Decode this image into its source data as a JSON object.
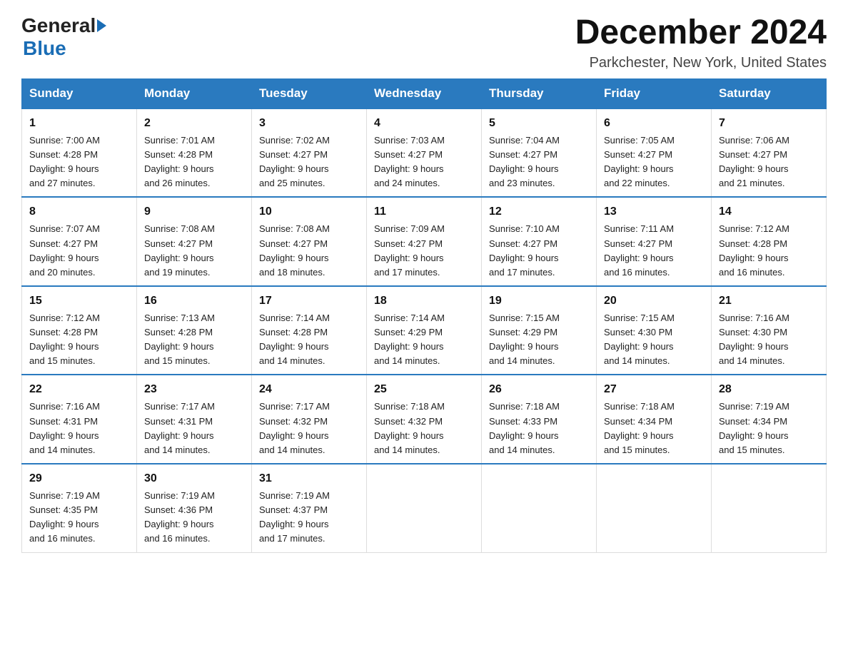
{
  "header": {
    "logo_general": "General",
    "logo_blue": "Blue",
    "title": "December 2024",
    "subtitle": "Parkchester, New York, United States"
  },
  "days_of_week": [
    "Sunday",
    "Monday",
    "Tuesday",
    "Wednesday",
    "Thursday",
    "Friday",
    "Saturday"
  ],
  "weeks": [
    [
      {
        "day": "1",
        "sunrise": "7:00 AM",
        "sunset": "4:28 PM",
        "daylight": "9 hours and 27 minutes."
      },
      {
        "day": "2",
        "sunrise": "7:01 AM",
        "sunset": "4:28 PM",
        "daylight": "9 hours and 26 minutes."
      },
      {
        "day": "3",
        "sunrise": "7:02 AM",
        "sunset": "4:27 PM",
        "daylight": "9 hours and 25 minutes."
      },
      {
        "day": "4",
        "sunrise": "7:03 AM",
        "sunset": "4:27 PM",
        "daylight": "9 hours and 24 minutes."
      },
      {
        "day": "5",
        "sunrise": "7:04 AM",
        "sunset": "4:27 PM",
        "daylight": "9 hours and 23 minutes."
      },
      {
        "day": "6",
        "sunrise": "7:05 AM",
        "sunset": "4:27 PM",
        "daylight": "9 hours and 22 minutes."
      },
      {
        "day": "7",
        "sunrise": "7:06 AM",
        "sunset": "4:27 PM",
        "daylight": "9 hours and 21 minutes."
      }
    ],
    [
      {
        "day": "8",
        "sunrise": "7:07 AM",
        "sunset": "4:27 PM",
        "daylight": "9 hours and 20 minutes."
      },
      {
        "day": "9",
        "sunrise": "7:08 AM",
        "sunset": "4:27 PM",
        "daylight": "9 hours and 19 minutes."
      },
      {
        "day": "10",
        "sunrise": "7:08 AM",
        "sunset": "4:27 PM",
        "daylight": "9 hours and 18 minutes."
      },
      {
        "day": "11",
        "sunrise": "7:09 AM",
        "sunset": "4:27 PM",
        "daylight": "9 hours and 17 minutes."
      },
      {
        "day": "12",
        "sunrise": "7:10 AM",
        "sunset": "4:27 PM",
        "daylight": "9 hours and 17 minutes."
      },
      {
        "day": "13",
        "sunrise": "7:11 AM",
        "sunset": "4:27 PM",
        "daylight": "9 hours and 16 minutes."
      },
      {
        "day": "14",
        "sunrise": "7:12 AM",
        "sunset": "4:28 PM",
        "daylight": "9 hours and 16 minutes."
      }
    ],
    [
      {
        "day": "15",
        "sunrise": "7:12 AM",
        "sunset": "4:28 PM",
        "daylight": "9 hours and 15 minutes."
      },
      {
        "day": "16",
        "sunrise": "7:13 AM",
        "sunset": "4:28 PM",
        "daylight": "9 hours and 15 minutes."
      },
      {
        "day": "17",
        "sunrise": "7:14 AM",
        "sunset": "4:28 PM",
        "daylight": "9 hours and 14 minutes."
      },
      {
        "day": "18",
        "sunrise": "7:14 AM",
        "sunset": "4:29 PM",
        "daylight": "9 hours and 14 minutes."
      },
      {
        "day": "19",
        "sunrise": "7:15 AM",
        "sunset": "4:29 PM",
        "daylight": "9 hours and 14 minutes."
      },
      {
        "day": "20",
        "sunrise": "7:15 AM",
        "sunset": "4:30 PM",
        "daylight": "9 hours and 14 minutes."
      },
      {
        "day": "21",
        "sunrise": "7:16 AM",
        "sunset": "4:30 PM",
        "daylight": "9 hours and 14 minutes."
      }
    ],
    [
      {
        "day": "22",
        "sunrise": "7:16 AM",
        "sunset": "4:31 PM",
        "daylight": "9 hours and 14 minutes."
      },
      {
        "day": "23",
        "sunrise": "7:17 AM",
        "sunset": "4:31 PM",
        "daylight": "9 hours and 14 minutes."
      },
      {
        "day": "24",
        "sunrise": "7:17 AM",
        "sunset": "4:32 PM",
        "daylight": "9 hours and 14 minutes."
      },
      {
        "day": "25",
        "sunrise": "7:18 AM",
        "sunset": "4:32 PM",
        "daylight": "9 hours and 14 minutes."
      },
      {
        "day": "26",
        "sunrise": "7:18 AM",
        "sunset": "4:33 PM",
        "daylight": "9 hours and 14 minutes."
      },
      {
        "day": "27",
        "sunrise": "7:18 AM",
        "sunset": "4:34 PM",
        "daylight": "9 hours and 15 minutes."
      },
      {
        "day": "28",
        "sunrise": "7:19 AM",
        "sunset": "4:34 PM",
        "daylight": "9 hours and 15 minutes."
      }
    ],
    [
      {
        "day": "29",
        "sunrise": "7:19 AM",
        "sunset": "4:35 PM",
        "daylight": "9 hours and 16 minutes."
      },
      {
        "day": "30",
        "sunrise": "7:19 AM",
        "sunset": "4:36 PM",
        "daylight": "9 hours and 16 minutes."
      },
      {
        "day": "31",
        "sunrise": "7:19 AM",
        "sunset": "4:37 PM",
        "daylight": "9 hours and 17 minutes."
      },
      null,
      null,
      null,
      null
    ]
  ],
  "labels": {
    "sunrise": "Sunrise:",
    "sunset": "Sunset:",
    "daylight": "Daylight:"
  }
}
